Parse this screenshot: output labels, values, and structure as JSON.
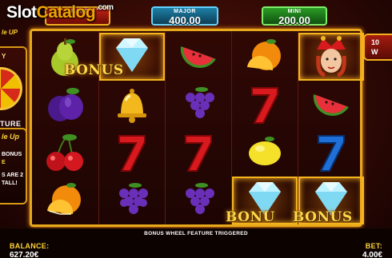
{
  "watermark": {
    "part1": "Slot",
    "part2": "Catalog",
    "suffix": ".com"
  },
  "jackpots": {
    "grand": {
      "label": "GRAND",
      "value": ""
    },
    "major": {
      "label": "MAJOR",
      "value": "400.00"
    },
    "mini": {
      "label": "MINI",
      "value": "200.00"
    }
  },
  "left_panel": {
    "logo_fragment": "le UP",
    "wheel_fragment": "Y",
    "feature_fragment": "TURE",
    "power_title": "le Up",
    "line1": "BONUS",
    "line2": "E",
    "line3": "S ARE 2",
    "line4": "TALL!"
  },
  "right_panel": {
    "line1": "10",
    "line2": "W"
  },
  "reels": [
    [
      "pear",
      "diamond",
      "plum",
      "cherries",
      "orange"
    ],
    [
      "diamond",
      "bell",
      "seven",
      "grapes"
    ],
    [
      "watermelon",
      "grapes",
      "seven",
      "grapes"
    ],
    [
      "orange",
      "seven",
      "lemon",
      "diamond"
    ],
    [
      "joker",
      "watermelon",
      "seven",
      "diamond"
    ]
  ],
  "bonus_labels": [
    "BONUS",
    "BONU",
    "BONUS"
  ],
  "message": "BONUS WHEEL FEATURE TRIGGERED",
  "balance": {
    "label": "BALANCE:",
    "value": "627.20€"
  },
  "bet": {
    "label": "BET:",
    "value": "4.00€"
  },
  "colors": {
    "frame": "#e8a91a",
    "accent": "#ffd23a",
    "grand": "#c22416",
    "major": "#1d7fa6",
    "mini": "#2a9c25"
  }
}
